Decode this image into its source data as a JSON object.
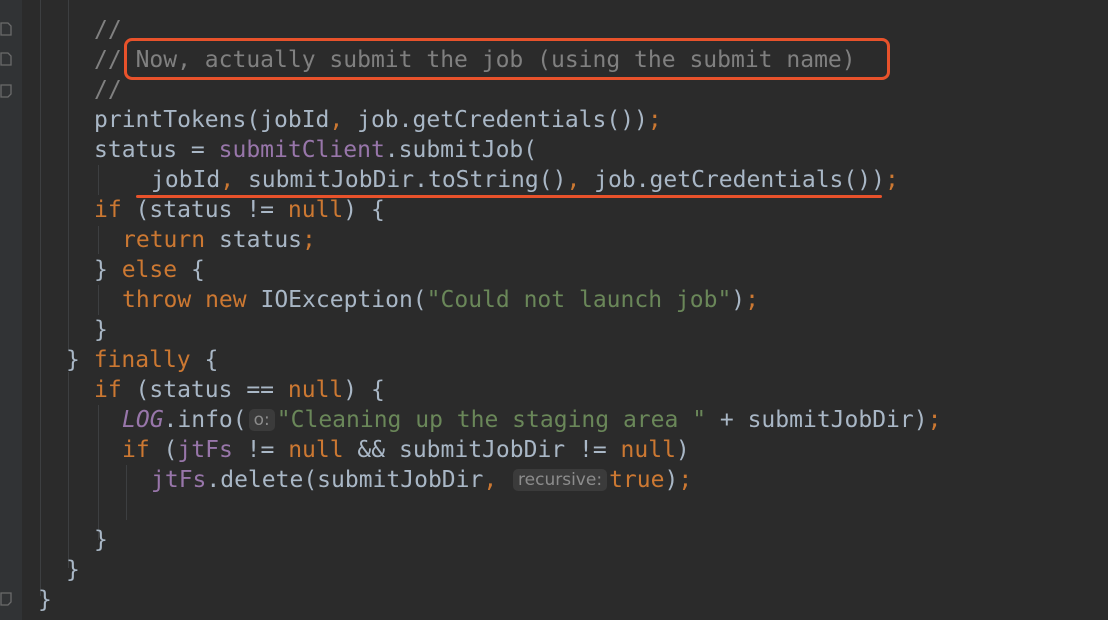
{
  "editor": {
    "colors": {
      "background": "#2b2b2b",
      "keyword": "#cc7832",
      "comment": "#808080",
      "string": "#6a8759",
      "field": "#9876aa",
      "text": "#a9b7c6",
      "annotation": "#e8522b"
    },
    "code": {
      "c1": "//",
      "c2_slashes": "//",
      "c2_text": "Now, actually submit the job (using the submit name)",
      "c3": "//",
      "l4_a": "printTokens(jobId",
      "l4_b": ", ",
      "l4_c": "job.getCredentials())",
      "l4_d": ";",
      "l5_a": "status = ",
      "l5_b": "submitClient",
      "l5_c": ".submitJob(",
      "l6_a": "jobId",
      "l6_b": ", ",
      "l6_c": "submitJobDir.toString()",
      "l6_d": ", ",
      "l6_e": "job.getCredentials())",
      "l6_f": ";",
      "l7_kw1": "if ",
      "l7_a": "(status != ",
      "l7_kw2": "null",
      "l7_b": ") {",
      "l8_kw": "return ",
      "l8_a": "status",
      "l8_b": ";",
      "l9_a": "} ",
      "l9_kw": "else ",
      "l9_b": "{",
      "l10_kw": "throw new ",
      "l10_a": "IOException(",
      "l10_str": "\"Could not launch job\"",
      "l10_b": ")",
      "l10_c": ";",
      "l11": "}",
      "l12_a": "} ",
      "l12_kw": "finally ",
      "l12_b": "{",
      "l13_kw1": "if ",
      "l13_a": "(status == ",
      "l13_kw2": "null",
      "l13_b": ") {",
      "l14_fld": "LOG",
      "l14_a": ".info(",
      "l14_hint": "o:",
      "l14_str": "\"Cleaning up the staging area \"",
      "l14_b": " + submitJobDir)",
      "l14_c": ";",
      "l15_kw1": "if ",
      "l15_a": "(",
      "l15_fld1": "jtFs",
      "l15_b": " != ",
      "l15_kw2": "null",
      "l15_c": " && submitJobDir != ",
      "l15_kw3": "null",
      "l15_d": ")",
      "l16_fld": "jtFs",
      "l16_a": ".delete(submitJobDir",
      "l16_b": ", ",
      "l16_hint": "recursive:",
      "l16_kw": "true",
      "l16_c": ")",
      "l16_d": ";",
      "l18": "}",
      "l19": "}",
      "l20": "}"
    }
  }
}
